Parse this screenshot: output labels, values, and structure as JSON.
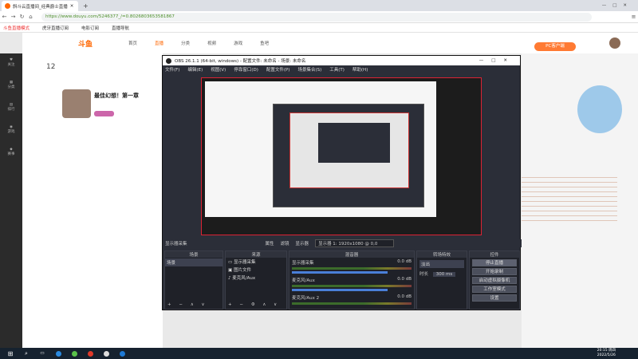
{
  "browser": {
    "tab_title": "斜斗云直播间_经典爵士直播",
    "url": "https://www.douyu.com/5246377_/=0.8026803653581867",
    "bookmarks": [
      "斗鱼直播模式",
      "虎牙直播订阅",
      "电影订阅",
      "直播导航"
    ]
  },
  "site": {
    "logo": "斗鱼",
    "nav": [
      "首页",
      "直播",
      "分类",
      "视频",
      "游戏",
      "鱼吧"
    ],
    "pc_badge": "PC客户端",
    "room_title": "最佳幻想！第一章",
    "follow_count": "12",
    "sidebar": [
      "关注",
      "分类",
      "排行",
      "游戏",
      "赛事"
    ]
  },
  "obs": {
    "title": "OBS 26.1.1 (64-bit, windows) - 配置文件: 未命名 - 场景: 未命名",
    "menu": [
      "文件(F)",
      "编辑(E)",
      "视图(V)",
      "停靠窗口(D)",
      "配置文件(P)",
      "场景集合(S)",
      "工具(T)",
      "帮助(H)"
    ],
    "scenebar": {
      "label": "显示器采集",
      "props": "属性",
      "filter": "滤镜",
      "display": "显示器",
      "display_value": "显示器 1: 1920x1080 @ 0,0"
    },
    "scenes_title": "场景",
    "scenes": [
      "场景"
    ],
    "sources_title": "来源",
    "sources": [
      "显示器采集",
      "图片文件",
      "麦克风/Aux"
    ],
    "mixer_title": "混音器",
    "mixer": [
      {
        "name": "显示器采集",
        "db": "0.0 dB"
      },
      {
        "name": "麦克风/Aux",
        "db": "0.0 dB"
      },
      {
        "name": "麦克风/Aux 2",
        "db": "0.0 dB"
      }
    ],
    "transition_title": "转场特效",
    "transition": {
      "type": "淡出",
      "duration_label": "时长",
      "duration": "300 ms"
    },
    "controls_title": "控件",
    "controls": [
      "停止直播",
      "开始录制",
      "启动虚拟摄像机",
      "工作室模式",
      "设置",
      "退出"
    ]
  },
  "taskbar": {
    "time": "20:15 周四",
    "date": "2022/5/26"
  }
}
